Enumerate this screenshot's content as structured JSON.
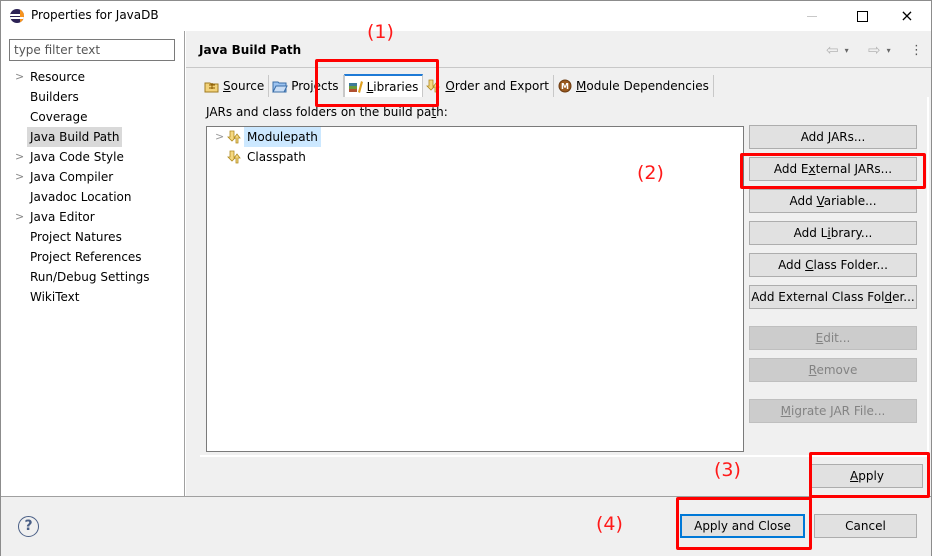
{
  "window": {
    "title": "Properties for JavaDB",
    "controls": {
      "minimize": "minimize",
      "maximize": "maximize",
      "close": "×"
    }
  },
  "sidebar": {
    "filter_placeholder": "type filter text",
    "filter_value": "",
    "items": [
      {
        "label": "Resource",
        "expandable": true,
        "selected": false
      },
      {
        "label": "Builders",
        "expandable": false,
        "selected": false
      },
      {
        "label": "Coverage",
        "expandable": false,
        "selected": false
      },
      {
        "label": "Java Build Path",
        "expandable": false,
        "selected": true
      },
      {
        "label": "Java Code Style",
        "expandable": true,
        "selected": false
      },
      {
        "label": "Java Compiler",
        "expandable": true,
        "selected": false
      },
      {
        "label": "Javadoc Location",
        "expandable": false,
        "selected": false
      },
      {
        "label": "Java Editor",
        "expandable": true,
        "selected": false
      },
      {
        "label": "Project Natures",
        "expandable": false,
        "selected": false
      },
      {
        "label": "Project References",
        "expandable": false,
        "selected": false
      },
      {
        "label": "Run/Debug Settings",
        "expandable": false,
        "selected": false
      },
      {
        "label": "WikiText",
        "expandable": false,
        "selected": false
      }
    ]
  },
  "page": {
    "title": "Java Build Path",
    "nav": {
      "back": "⇦",
      "forward": "⇨",
      "dropdown": "▾",
      "more": "⋮"
    },
    "tabs": [
      {
        "pre": "",
        "mnemonic": "S",
        "post": "ource",
        "icon": "source-folder-icon",
        "active": false
      },
      {
        "pre": "Pro",
        "mnemonic": "j",
        "post": "ects",
        "icon": "projects-folder-icon",
        "active": false
      },
      {
        "pre": "",
        "mnemonic": "L",
        "post": "ibraries",
        "icon": "libraries-books-icon",
        "active": true
      },
      {
        "pre": "",
        "mnemonic": "O",
        "post": "rder and Export",
        "icon": "order-export-arrows-icon",
        "active": false
      },
      {
        "pre": "",
        "mnemonic": "M",
        "post": "odule Dependencies",
        "icon": "module-icon",
        "active": false
      }
    ],
    "libraries": {
      "label_pre": "JARs and class folders on the build pa",
      "label_mnemonic": "t",
      "label_post": "h:",
      "entries": [
        {
          "label": "Modulepath",
          "expandable": true,
          "selected": true
        },
        {
          "label": "Classpath",
          "expandable": false,
          "selected": false
        }
      ],
      "buttons": [
        {
          "pre": "Add ",
          "mnemonic": "J",
          "post": "ARs...",
          "enabled": true
        },
        {
          "pre": "Add E",
          "mnemonic": "x",
          "post": "ternal JARs...",
          "enabled": true
        },
        {
          "pre": "Add ",
          "mnemonic": "V",
          "post": "ariable...",
          "enabled": true
        },
        {
          "pre": "Add L",
          "mnemonic": "i",
          "post": "brary...",
          "enabled": true
        },
        {
          "pre": "Add ",
          "mnemonic": "C",
          "post": "lass Folder...",
          "enabled": true
        },
        {
          "pre": "Add External Class Fol",
          "mnemonic": "d",
          "post": "er...",
          "enabled": true
        },
        {
          "pre": "",
          "mnemonic": "E",
          "post": "dit...",
          "enabled": false
        },
        {
          "pre": "",
          "mnemonic": "R",
          "post": "emove",
          "enabled": false
        },
        {
          "pre": "",
          "mnemonic": "M",
          "post": "igrate JAR File...",
          "enabled": false
        }
      ]
    },
    "apply": {
      "pre": "",
      "mnemonic": "A",
      "post": "pply"
    }
  },
  "footer": {
    "help": "?",
    "apply_and_close": "Apply and Close",
    "cancel": "Cancel"
  },
  "annotations": {
    "color": "#ff0000",
    "labels": [
      "(1)",
      "(2)",
      "(3)",
      "(4)"
    ]
  }
}
